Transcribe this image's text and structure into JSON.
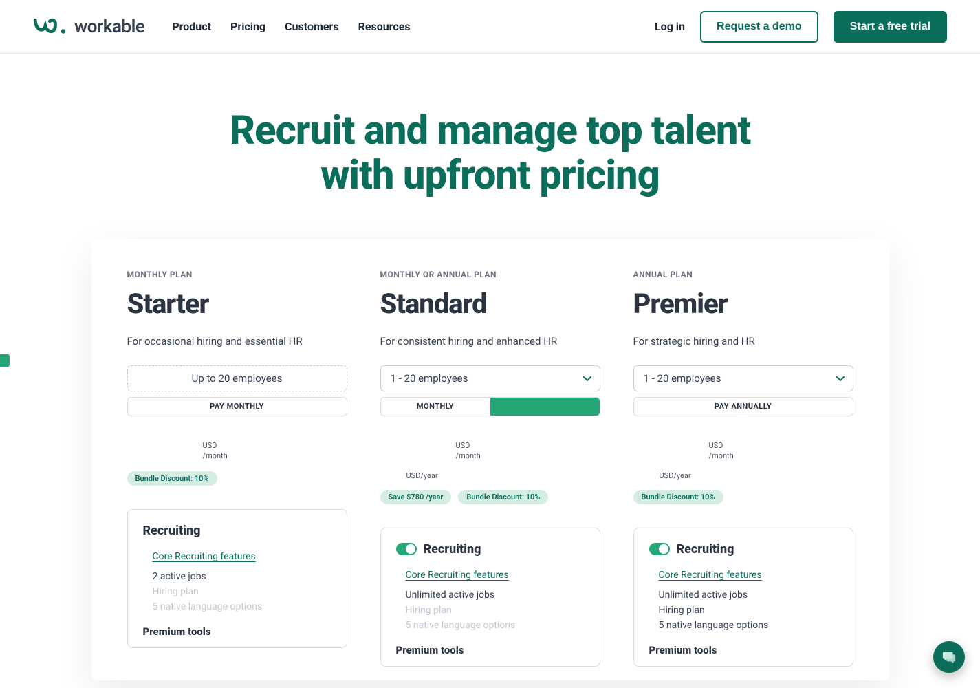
{
  "nav": {
    "items": [
      "Product",
      "Pricing",
      "Customers",
      "Resources"
    ],
    "login": "Log in",
    "request_demo": "Request a demo",
    "start_trial": "Start a free trial"
  },
  "brand": {
    "name": "workable"
  },
  "hero": {
    "title_line1": "Recruit and manage top talent",
    "title_line2": "with upfront pricing"
  },
  "shared": {
    "core_link": "Core Recruiting features",
    "recruiting_heading": "Recruiting",
    "premium_heading": "Premium tools",
    "price_currency": "USD",
    "price_period": "/month",
    "annual_suffix": "USD/year",
    "bundle_discount": "Bundle Discount: 10%"
  },
  "plans": [
    {
      "eyebrow": "MONTHLY PLAN",
      "name": "Starter",
      "tagline": "For occasional hiring and essential HR",
      "employee_label": "Up to 20 employees",
      "cycle": {
        "type": "single",
        "label": "PAY MONTHLY"
      },
      "has_sub_year": false,
      "has_toggle": false,
      "save_badge": null,
      "features": [
        {
          "text": "2 active jobs",
          "muted": false
        },
        {
          "text": "Hiring plan",
          "muted": true
        },
        {
          "text": "5 native language options",
          "muted": true
        }
      ]
    },
    {
      "eyebrow": "MONTHLY OR ANNUAL PLAN",
      "name": "Standard",
      "tagline": "For consistent hiring and enhanced HR",
      "employee_label": "1 - 20 employees",
      "cycle": {
        "type": "split",
        "left": "MONTHLY",
        "active": "right"
      },
      "has_sub_year": true,
      "has_toggle": true,
      "save_badge": "Save $780 /year",
      "features": [
        {
          "text": "Unlimited active jobs",
          "muted": false
        },
        {
          "text": "Hiring plan",
          "muted": true
        },
        {
          "text": "5 native language options",
          "muted": true
        }
      ]
    },
    {
      "eyebrow": "ANNUAL PLAN",
      "name": "Premier",
      "tagline": "For strategic hiring and HR",
      "employee_label": "1 - 20 employees",
      "cycle": {
        "type": "single",
        "label": "PAY ANNUALLY"
      },
      "has_sub_year": true,
      "has_toggle": true,
      "save_badge": null,
      "features": [
        {
          "text": "Unlimited active jobs",
          "muted": false
        },
        {
          "text": "Hiring plan",
          "muted": false
        },
        {
          "text": "5 native language options",
          "muted": false
        }
      ]
    }
  ]
}
